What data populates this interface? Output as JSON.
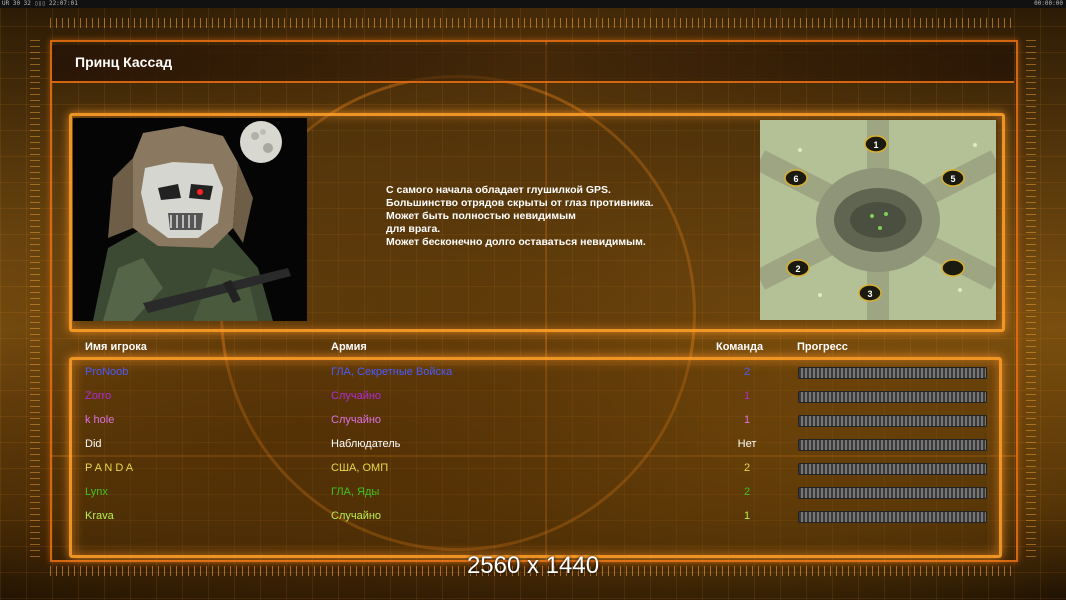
{
  "system": {
    "info": "UR 30 32 ▯▯▯ 22:07:01",
    "clock": "00:00:00"
  },
  "header": {
    "title": "Принц Кассад"
  },
  "general": {
    "description": [
      "С самого начала обладает глушилкой GPS.",
      "Большинство отрядов скрыты от глаз противника.",
      "Может быть полностью невидимым",
      "для врага.",
      "Может бесконечно долго оставаться невидимым."
    ]
  },
  "map": {
    "slots": [
      "1",
      "2",
      "3",
      "5",
      "6"
    ]
  },
  "table": {
    "headers": {
      "name": "Имя игрока",
      "army": "Армия",
      "team": "Команда",
      "progress": "Прогресс"
    },
    "rows": [
      {
        "name": "ProNoob",
        "army": "ГЛА, Секретные Войска",
        "team": "2",
        "color": "#4a5cff",
        "progress": 0
      },
      {
        "name": "Zorro",
        "army": "Случайно",
        "team": "1",
        "color": "#b12cd1",
        "progress": 0
      },
      {
        "name": "k hole",
        "army": "Случайно",
        "team": "1",
        "color": "#e070e0",
        "progress": 0
      },
      {
        "name": "Did",
        "army": "Наблюдатель",
        "team": "Нет",
        "color": "#ffffff",
        "progress": 0
      },
      {
        "name": "P A N D A",
        "army": "США, ОМП",
        "team": "2",
        "color": "#e8d84a",
        "progress": 0
      },
      {
        "name": "Lynx",
        "army": "ГЛА, Яды",
        "team": "2",
        "color": "#3fc21c",
        "progress": 0
      },
      {
        "name": "Krava",
        "army": "Случайно",
        "team": "1",
        "color": "#b7f04a",
        "progress": 0
      }
    ]
  },
  "footer": {
    "resolution": "2560 x 1440"
  }
}
